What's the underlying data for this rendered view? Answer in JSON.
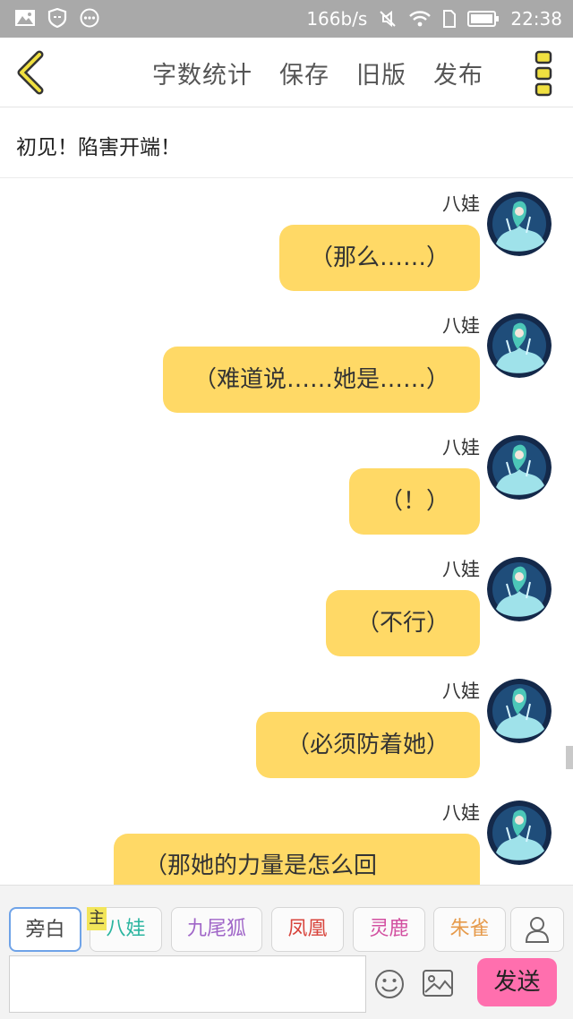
{
  "status_bar": {
    "speed": "166b/s",
    "time": "22:38",
    "icons": [
      "image-icon",
      "shield-icon",
      "more-dots-icon",
      "mute-icon",
      "wifi-icon",
      "sim-icon",
      "battery-icon"
    ]
  },
  "toolbar": {
    "back_icon": "chevron-left-icon",
    "actions": [
      "字数统计",
      "保存",
      "旧版",
      "发布"
    ],
    "more_icon": "vertical-dots-icon",
    "accent_color": "#f0e040"
  },
  "chapter_title": "初见！陷害开端！",
  "messages": [
    {
      "name": "八娃",
      "text": "（那么……）"
    },
    {
      "name": "八娃",
      "text": "（难道说……她是……）"
    },
    {
      "name": "八娃",
      "text": "（！）"
    },
    {
      "name": "八娃",
      "text": "（不行）"
    },
    {
      "name": "八娃",
      "text": "（必须防着她）"
    },
    {
      "name": "八娃",
      "text": "（那她的力量是怎么回"
    }
  ],
  "bubble_color": "#ffd966",
  "roles": {
    "narration": "旁白",
    "main_tag": "主",
    "items": [
      {
        "label": "八娃",
        "color": "#2bb5a0"
      },
      {
        "label": "九尾狐",
        "color": "#a066c8"
      },
      {
        "label": "凤凰",
        "color": "#d8443c"
      },
      {
        "label": "灵鹿",
        "color": "#d24fa0"
      },
      {
        "label": "朱雀",
        "color": "#e69a4a"
      }
    ],
    "add_role_icon": "user-icon"
  },
  "input": {
    "value": "",
    "emoji_icon": "emoji-icon",
    "image_icon": "picture-icon",
    "send_label": "发送",
    "send_color": "#ff6fae"
  }
}
